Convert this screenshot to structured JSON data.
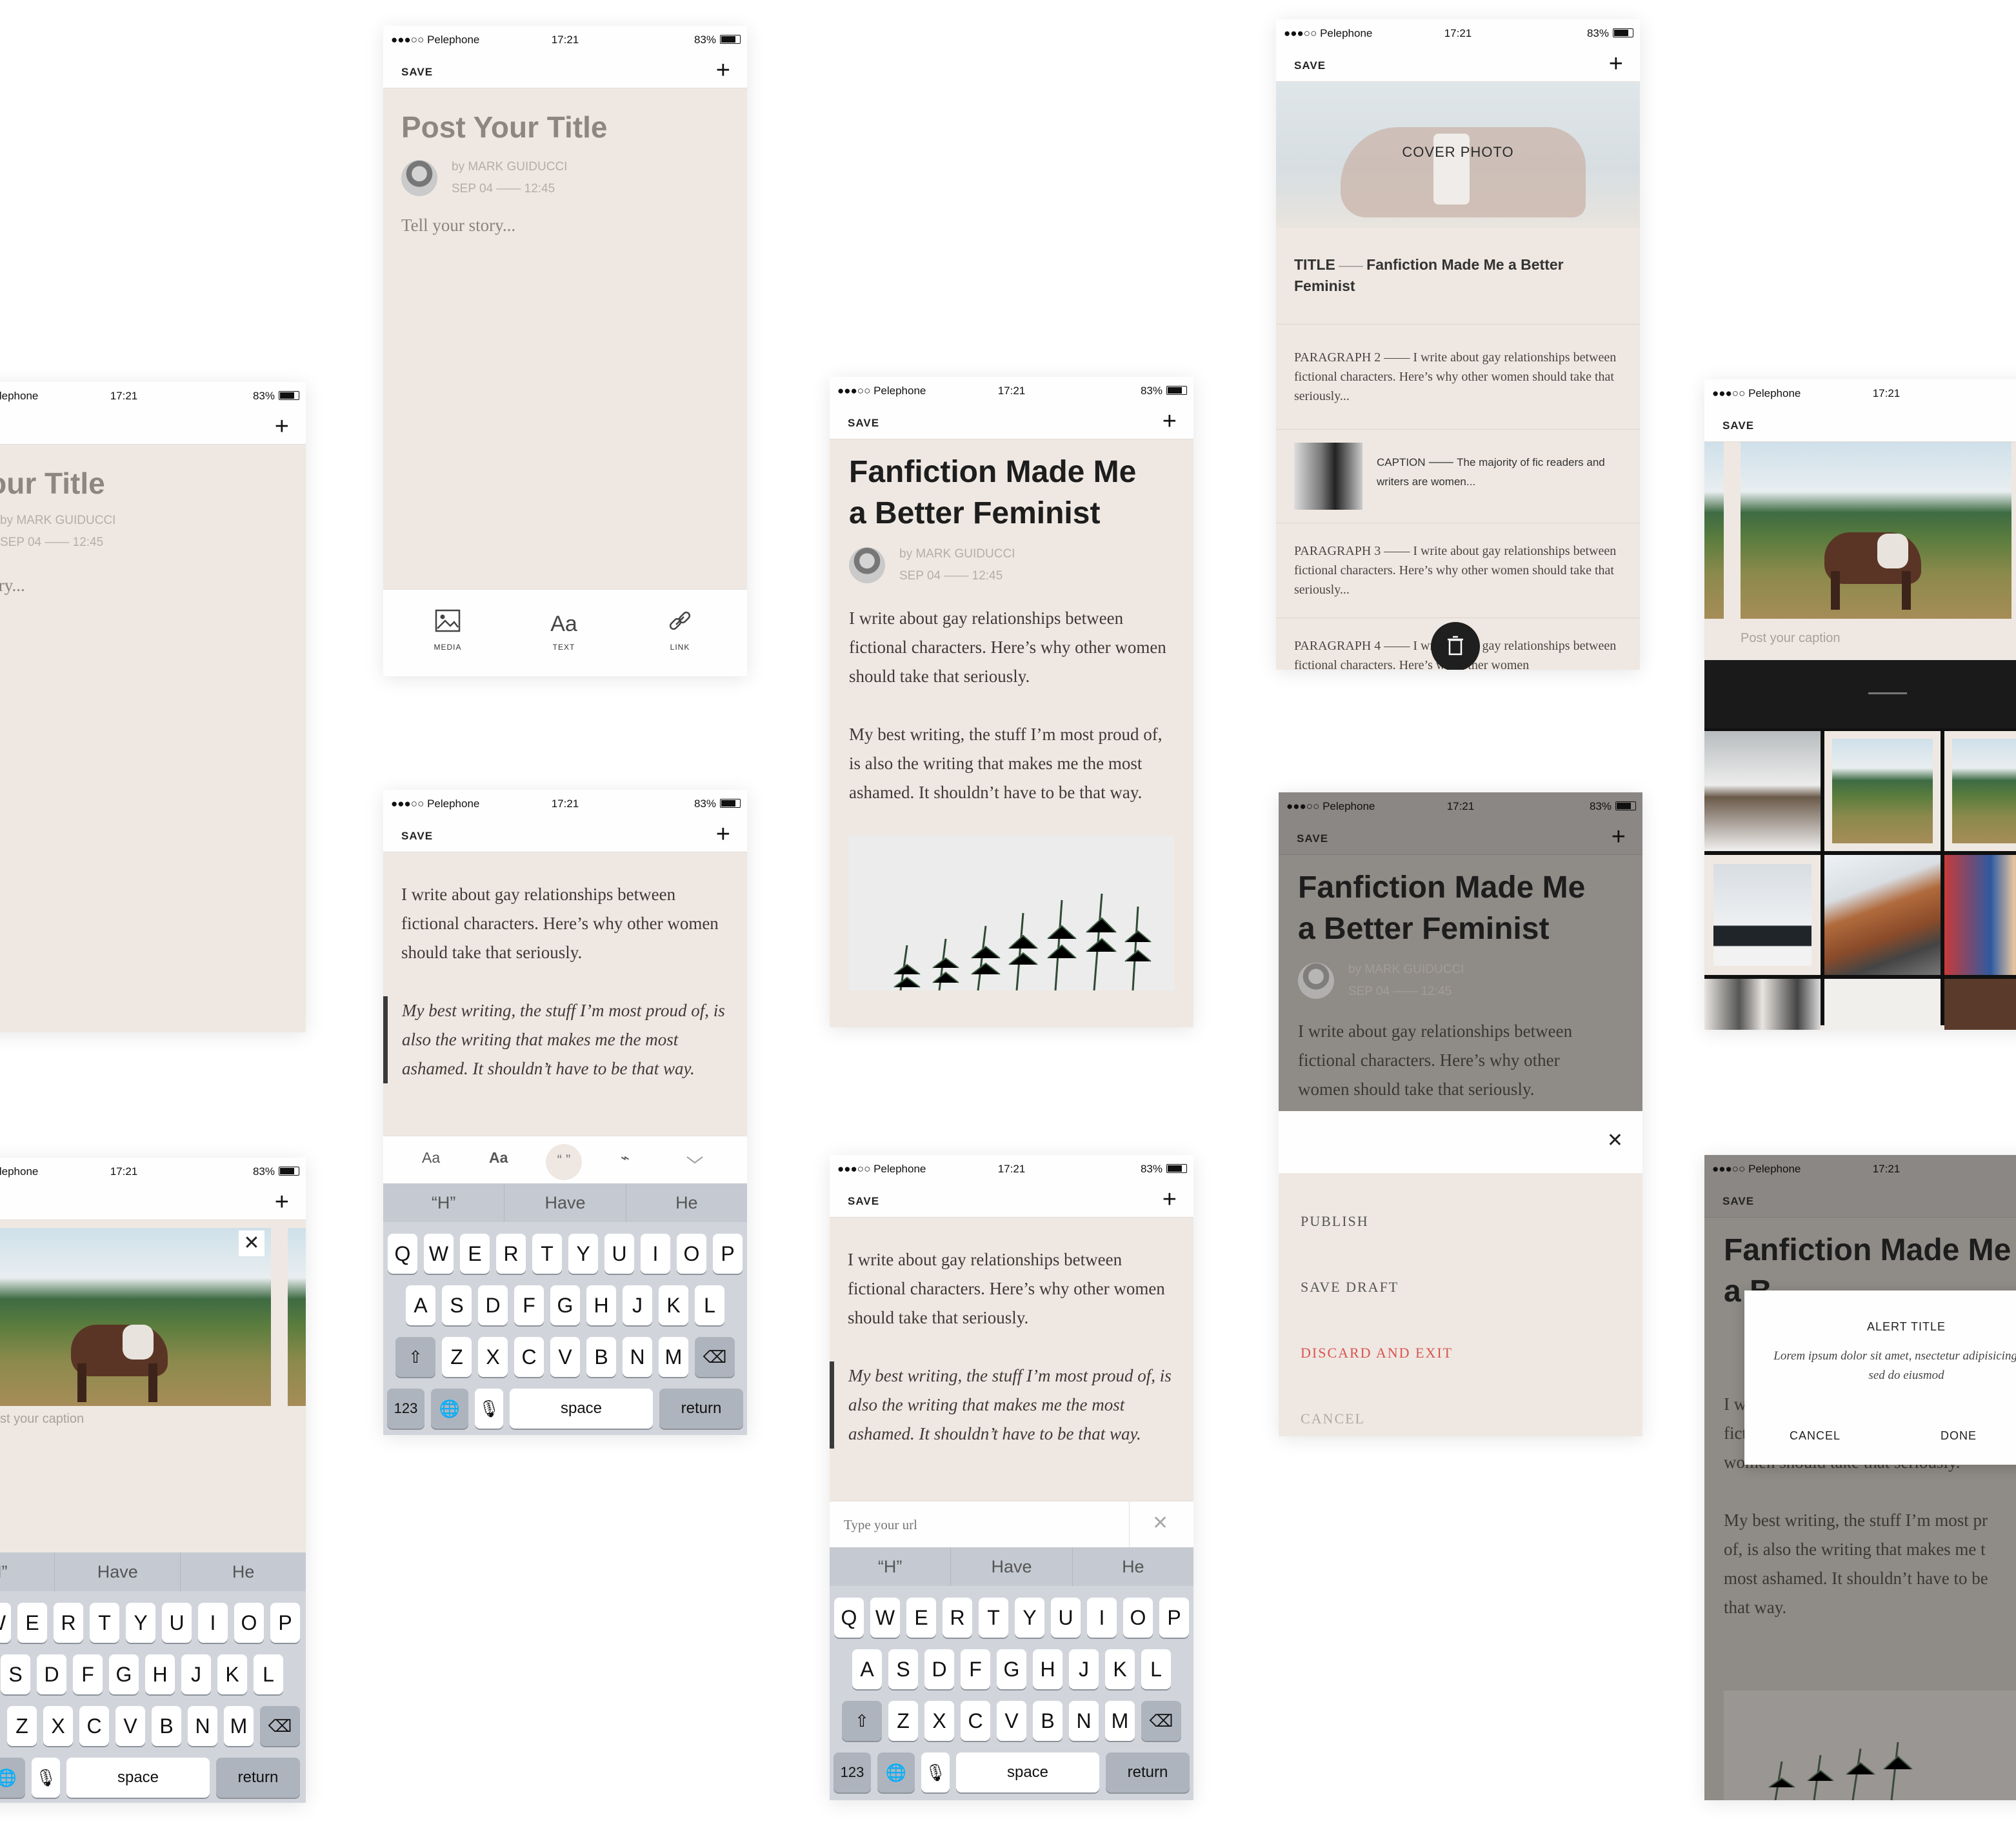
{
  "status": {
    "carrier": "●●●○○ Pelephone",
    "time": "17:21",
    "battery": "83%"
  },
  "nav": {
    "save": "SAVE",
    "plus": "+"
  },
  "post": {
    "title_placeholder": "Post Your Title",
    "title_placeholder_partial": "st Your Title",
    "author": "by MARK GUIDUCCI",
    "date": "SEP 04 —— 12:45",
    "story_placeholder": "Tell your story...",
    "story_placeholder_partial": "your story..."
  },
  "article": {
    "title_line1": "Fanfiction Made Me",
    "title_line2": "a Better Feminist",
    "para1": "I write about gay relationships between fictional characters. Here’s why other women should take that seriously.",
    "para2": "My best writing, the stuff I’m most proud of, is also the writing that makes me the most ashamed. It shouldn’t have to be that way.",
    "dim_title_line1": "Fanfiction Made Me",
    "dim_title_line2_partial": "a B",
    "dim_para1": "I w",
    "dim_para1b": "fict",
    "dim_para1c": "women should take that seriously.",
    "dim_para2_l1": "My best writing, the stuff I’m most pr",
    "dim_para2_l2": "of, is also the writing that makes me t",
    "dim_para2_l3": "most ashamed. It shouldn’t have to be",
    "dim_para2_l4": "that way.",
    "dim2_para_l1": "I write about gay relationships between",
    "dim2_para_l2": "fictional characters. Here’s why other",
    "dim2_para_l3": "women should take that seriously."
  },
  "toolbar": {
    "media": "MEDIA",
    "text": "TEXT",
    "link": "LINK",
    "text_glyph": "Aa"
  },
  "format_bar": {
    "aa_small": "Aa",
    "aa_bold": "Aa",
    "quote": "“ ”"
  },
  "keyboard": {
    "suggestions": [
      "“H”",
      "Have",
      "He"
    ],
    "suggestions_partial": [
      "H”",
      "Have",
      "He"
    ],
    "row1": [
      "Q",
      "W",
      "E",
      "R",
      "T",
      "Y",
      "U",
      "I",
      "O",
      "P"
    ],
    "row1_partial": [
      "W",
      "E",
      "R",
      "T",
      "Y",
      "U",
      "I",
      "O",
      "P"
    ],
    "row2": [
      "A",
      "S",
      "D",
      "F",
      "G",
      "H",
      "J",
      "K",
      "L"
    ],
    "row2_partial": [
      "S",
      "D",
      "F",
      "G",
      "H",
      "J",
      "K",
      "L"
    ],
    "row3": [
      "Z",
      "X",
      "C",
      "V",
      "B",
      "N",
      "M"
    ],
    "numbers": "123",
    "space": "space",
    "return": "return",
    "shift": "⇧",
    "delete": "⌫",
    "globe": "🌐",
    "mic": "🎙"
  },
  "url_input": {
    "placeholder": "Type your url"
  },
  "caption": {
    "placeholder": "Post your caption",
    "placeholder_partial": "st your caption"
  },
  "sections": {
    "cover": "COVER PHOTO",
    "title_label": "TITLE",
    "title_value": "Fanfiction Made Me a Better Feminist",
    "p2_label": "PARAGRAPH 2",
    "p2_text": "I write about gay relationships between fictional characters. Here’s why other women should take that seriously...",
    "caption_label": "CAPTION",
    "caption_text": "The majority of fic readers and writers are women...",
    "p3_label": "PARAGRAPH 3",
    "p3_text": "I write about gay relationships between fictional characters. Here’s why other women should take that seriously...",
    "p4_label": "PARAGRAPH 4",
    "p4_text": "I write about gay relationships between fictional characters. Here’s why other women"
  },
  "action_menu": {
    "publish": "PUBLISH",
    "save_draft": "SAVE DRAFT",
    "discard": "DISCARD AND EXIT",
    "cancel": "CANCEL",
    "discard_color": "#d9534f"
  },
  "alert": {
    "title": "ALERT TITLE",
    "message": "Lorem ipsum dolor sit amet, nsectetur adipisicing elit, sed do eiusmod",
    "cancel": "CANCEL",
    "done": "DONE"
  },
  "colors": {
    "paper": "#efe8e2",
    "accent_dark": "#1d1d1d"
  }
}
